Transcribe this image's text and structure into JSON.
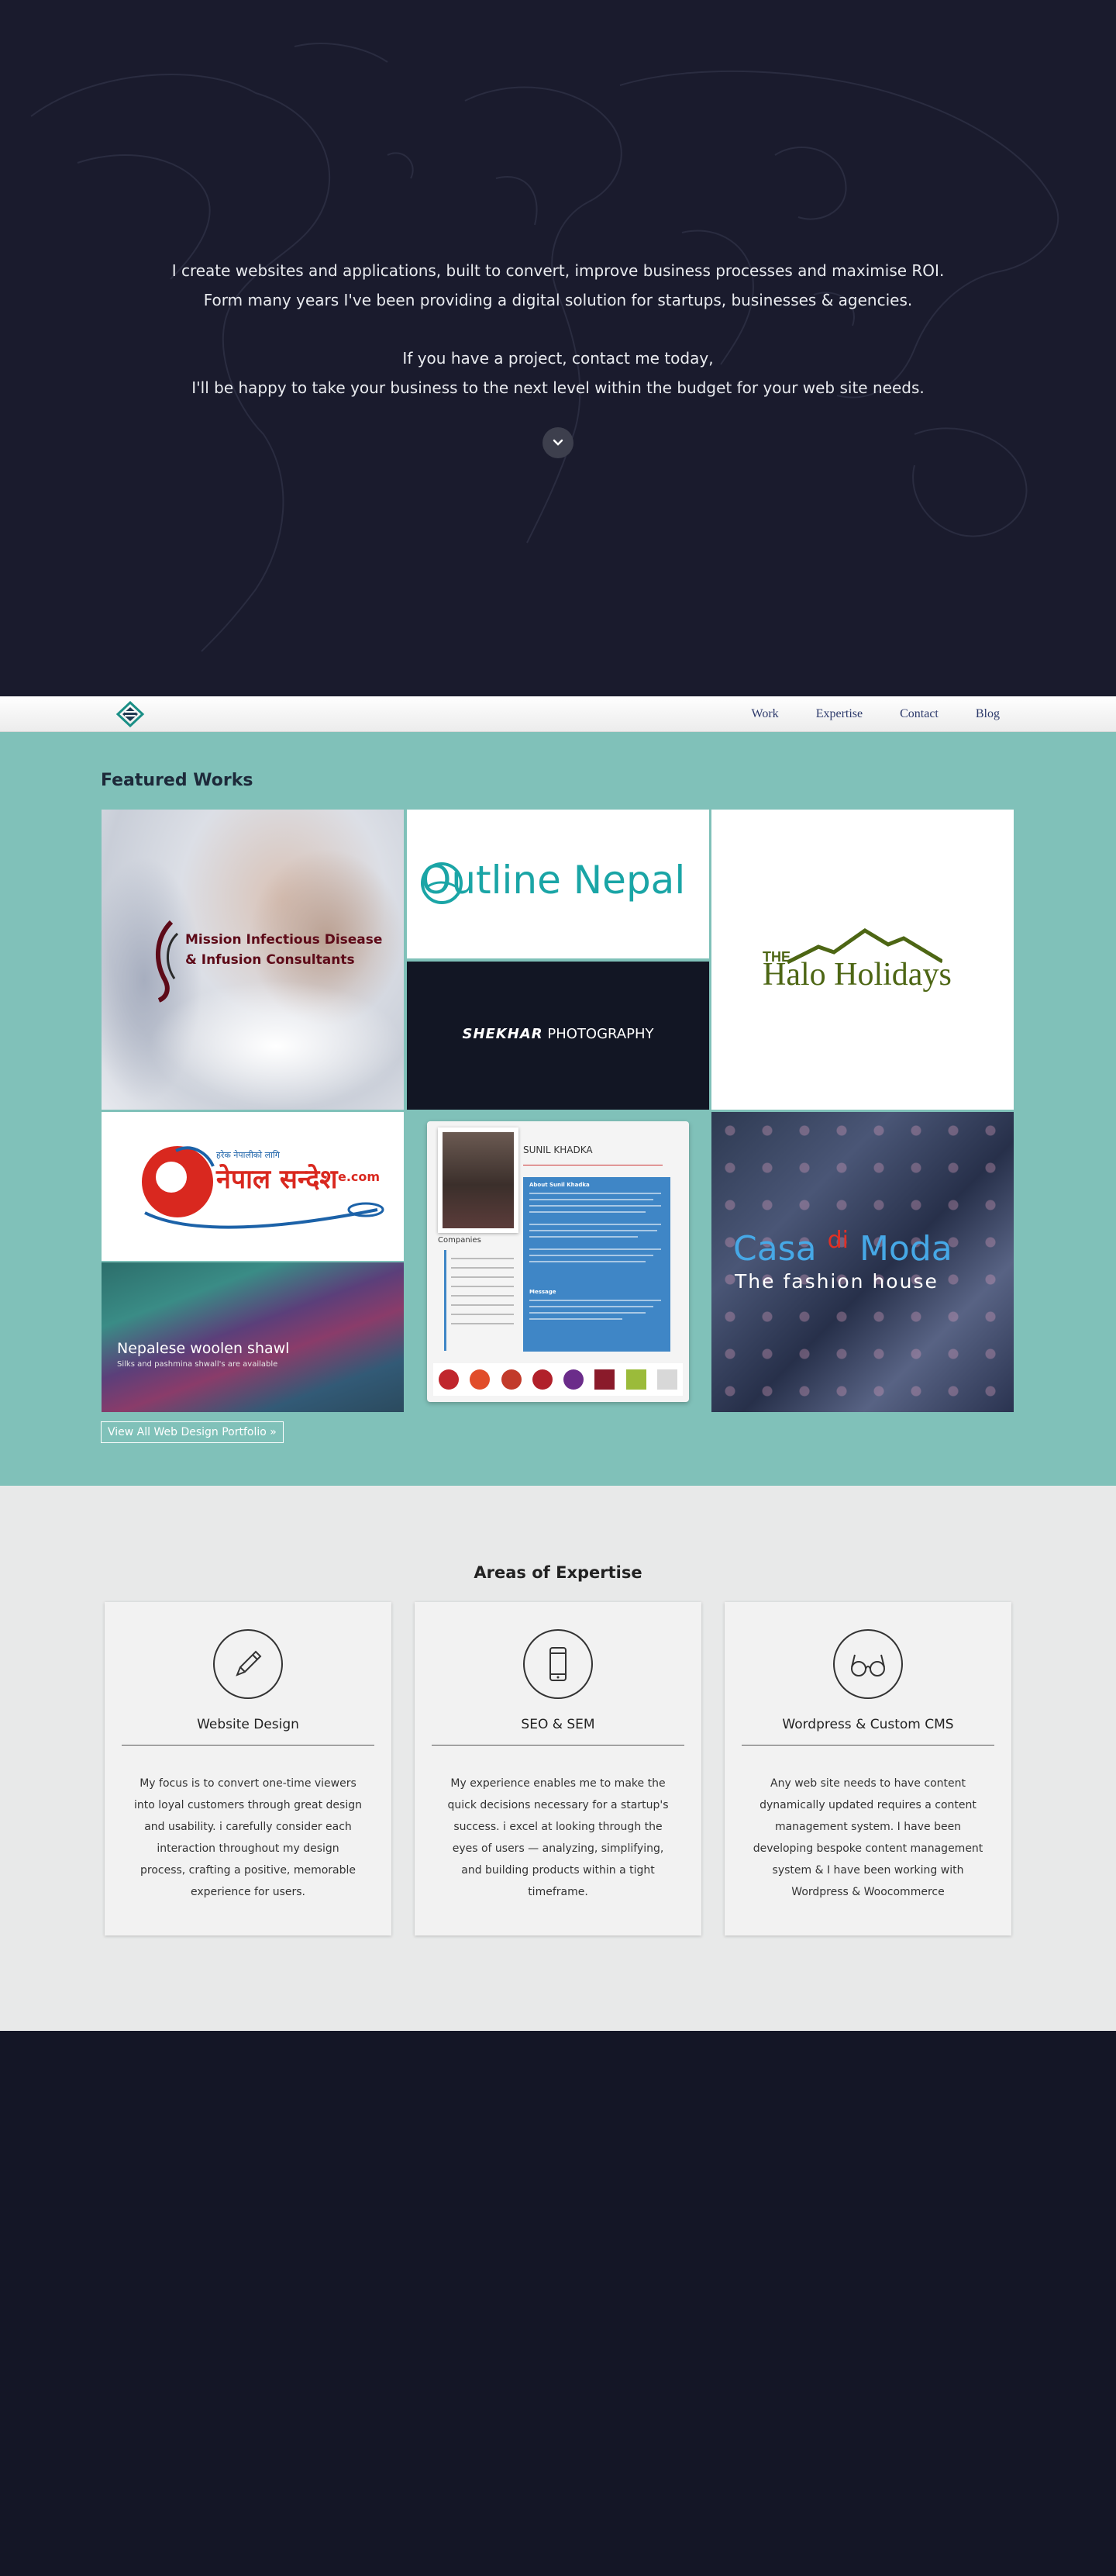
{
  "hero": {
    "line1": "I create websites and applications, built to convert, improve business processes and maximise ROI.",
    "line2": "Form many years I've been providing a digital solution for startups, businesses & agencies.",
    "line3": "If you have a project, contact me today,",
    "line4": "I'll be happy to take your business to the next level within the budget for your web site needs.",
    "scroll_icon": "chevron-down-icon"
  },
  "nav": {
    "logo_icon": "logo-mark-icon",
    "items": [
      "Work",
      "Expertise",
      "Contact",
      "Blog"
    ]
  },
  "featured": {
    "title": "Featured Works",
    "works": {
      "mission": "Mission Infectious Disease & Infusion Consultants",
      "outline": "Outline Nepal",
      "shekhar_bold": "SHEKHAR",
      "shekhar_rest": "PHOTOGRAPHY",
      "halo_the": "THE",
      "halo_name": "Halo Holidays",
      "nepal_sub": "हरेक नेपालीको लागि",
      "nepal_main": "नेपाल सन्देश",
      "nepal_ecom": "e.com",
      "shawl_title": "Nepalese woolen shawl",
      "shawl_sub": "Silks and pashmina shwall's are available",
      "sunil_name": "SUNIL KHADKA",
      "sunil_about": "About Sunil Khadka",
      "sunil_message": "Message",
      "sunil_companies": "Companies",
      "casa_a": "Casa ",
      "casa_d": "di",
      "casa_b": " Moda",
      "casa_sub": "The fashion house"
    },
    "view_all": "View All Web Design Portfolio »"
  },
  "expertise": {
    "title": "Areas of Expertise",
    "cards": [
      {
        "icon": "pen-icon",
        "title": "Website Design",
        "desc": "My focus is to convert one-time viewers into loyal customers through great design and usability. i carefully consider each interaction throughout my design process, crafting a positive, memorable experience for users."
      },
      {
        "icon": "mobile-phone-icon",
        "title": "SEO & SEM",
        "desc": "My experience enables me to make the quick decisions necessary for a startup's success. i excel at looking through the eyes of users — analyzing, simplifying, and building products within a tight timeframe."
      },
      {
        "icon": "glasses-icon",
        "title": "Wordpress & Custom CMS",
        "desc": "Any web site needs to have content dynamically updated requires a content management system. I have been developing bespoke content management system & I have been working with Wordpress & Woocommerce"
      }
    ]
  },
  "colors": {
    "hero_bg": "#1a1b2d",
    "featured_bg": "#80c1b9",
    "expertise_bg": "#e8e9e9",
    "footer_bg": "#141626",
    "nav_link": "#2d3a6b"
  }
}
